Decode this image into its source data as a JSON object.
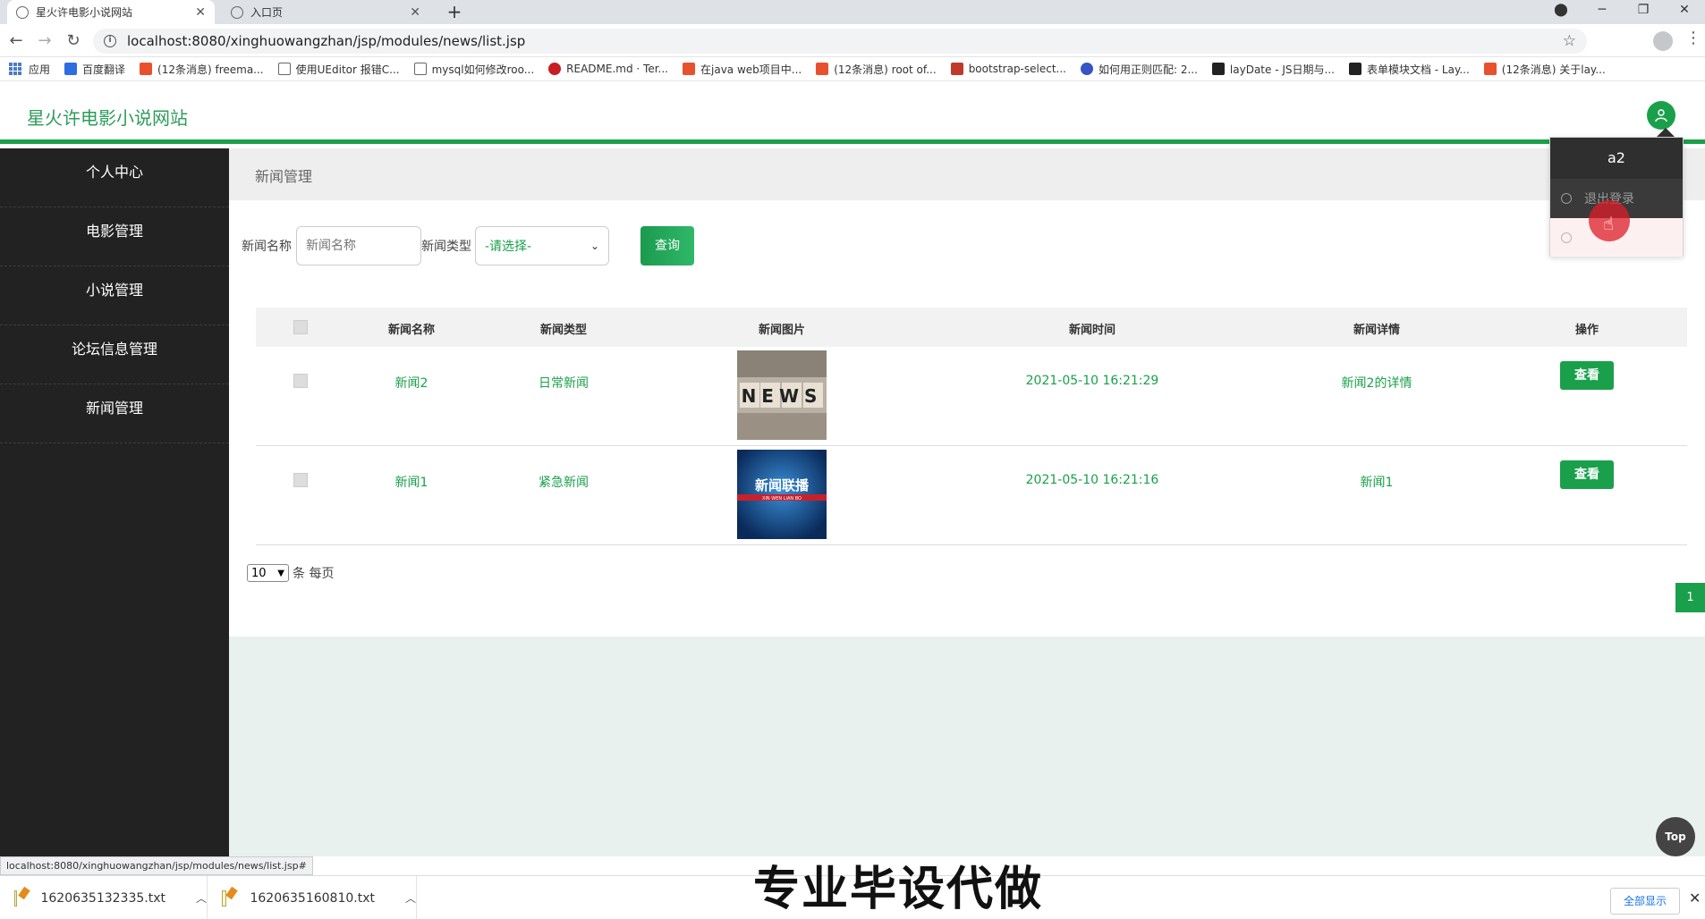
{
  "browser": {
    "tabs": [
      {
        "title": "星火许电影小说网站",
        "active": true
      },
      {
        "title": "入口页",
        "active": false
      }
    ],
    "url": "localhost:8080/xinghuowangzhan/jsp/modules/news/list.jsp",
    "bookmarks": [
      {
        "label": "应用",
        "color": "#4a79c9"
      },
      {
        "label": "百度翻译",
        "color": "#2f6ee0"
      },
      {
        "label": "(12条消息) freema...",
        "color": "#e8512d"
      },
      {
        "label": "使用UEditor 报错C...",
        "color": "#444444"
      },
      {
        "label": "mysql如何修改roo...",
        "color": "#444444"
      },
      {
        "label": "README.md · Ter...",
        "color": "#c71d23"
      },
      {
        "label": "在java web项目中...",
        "color": "#e8512d"
      },
      {
        "label": "(12条消息) root of...",
        "color": "#e8512d"
      },
      {
        "label": "bootstrap-select...",
        "color": "#c0392b"
      },
      {
        "label": "如何用正则匹配: 2...",
        "color": "#3654c4"
      },
      {
        "label": "layDate - JS日期与...",
        "color": "#222222"
      },
      {
        "label": "表单模块文档 - Lay...",
        "color": "#222222"
      },
      {
        "label": "(12条消息) 关于lay...",
        "color": "#e8512d"
      }
    ]
  },
  "app": {
    "site_title": "星火许电影小说网站",
    "accent_color": "#1aa04a"
  },
  "user_menu": {
    "username": "a2",
    "items": [
      "退出登录",
      ""
    ]
  },
  "sidebar": {
    "items": [
      "个人中心",
      "电影管理",
      "小说管理",
      "论坛信息管理",
      "新闻管理"
    ]
  },
  "breadcrumb": "新闻管理",
  "search": {
    "name_label": "新闻名称",
    "name_placeholder": "新闻名称",
    "type_label": "新闻类型",
    "type_selected": "-请选择-",
    "query_button": "查询"
  },
  "table": {
    "headers": [
      "新闻名称",
      "新闻类型",
      "新闻图片",
      "新闻时间",
      "新闻详情",
      "操作"
    ],
    "rows": [
      {
        "name": "新闻2",
        "type": "日常新闻",
        "image": "news-blocks",
        "time": "2021-05-10 16:21:29",
        "detail": "新闻2的详情",
        "action": "查看"
      },
      {
        "name": "新闻1",
        "type": "紧急新闻",
        "image": "xinwen-lianbo",
        "time": "2021-05-10 16:21:16",
        "detail": "新闻1",
        "action": "查看"
      }
    ]
  },
  "pagination": {
    "page_size": "10",
    "page_size_suffix": "条 每页",
    "current_page": "1"
  },
  "top_button": "Top",
  "status_url": "localhost:8080/xinghuowangzhan/jsp/modules/news/list.jsp#",
  "downloads": {
    "files": [
      "1620635132335.txt",
      "1620635160810.txt"
    ],
    "show_all": "全部显示"
  },
  "watermark": "专业毕设代做",
  "thumb_text": {
    "news_letters": "NEWS",
    "cctv_title": "新闻联播",
    "cctv_sub": "XIN WEN LIAN BO"
  }
}
